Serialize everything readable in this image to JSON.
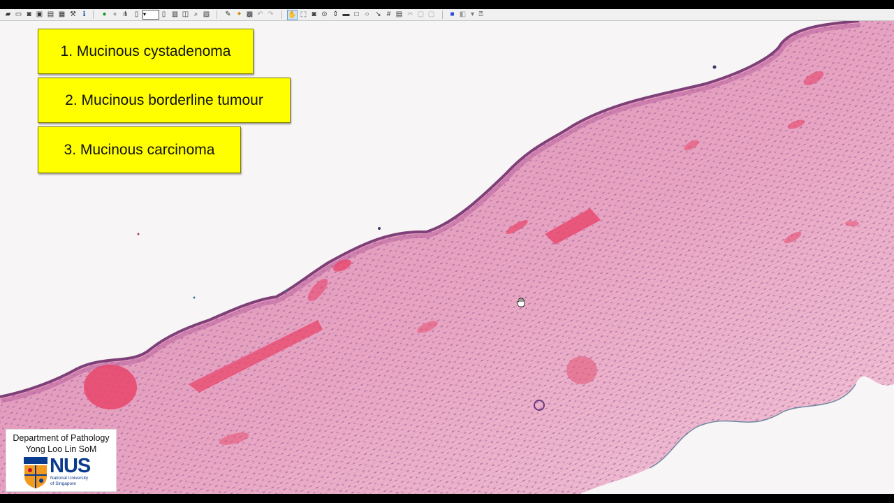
{
  "toolbar": {
    "icons": [
      "open-icon",
      "open-folder-icon",
      "camera-icon",
      "capture-icon",
      "print-icon",
      "export-icon",
      "settings-icon",
      "info-icon",
      "go-icon",
      "stop-icon",
      "network-icon",
      "layout-icon",
      "zoom-combo",
      "page-icon",
      "copy-icon",
      "fit-icon",
      "magnify-icon",
      "image-icon",
      "annotate-icon",
      "highlight-icon",
      "layers-icon",
      "undo-icon",
      "redo-icon",
      "hand-tool-icon",
      "select-tool-icon",
      "camera-tool-icon",
      "pin-icon",
      "measure-icon",
      "ruler-icon",
      "rectangle-icon",
      "ellipse-icon",
      "arrow-icon",
      "grid-icon",
      "label-icon",
      "disabled-icon-1",
      "disabled-icon-2",
      "disabled-icon-3",
      "color-icon",
      "filter-icon",
      "help-icon"
    ]
  },
  "choices": [
    {
      "label": "1. Mucinous cystadenoma"
    },
    {
      "label": "2. Mucinous borderline tumour"
    },
    {
      "label": "3. Mucinous carcinoma"
    }
  ],
  "logo": {
    "line1": "Department of Pathology",
    "line2": "Yong Loo Lin SoM",
    "brand": "NUS",
    "sub1": "National University",
    "sub2": "of Singapore"
  },
  "colors": {
    "choice_bg": "#ffff00",
    "tissue": "#e7a4c2",
    "epithelium": "#7f3f78",
    "vessel": "#e8456a",
    "nus_blue": "#0b3b8c"
  }
}
